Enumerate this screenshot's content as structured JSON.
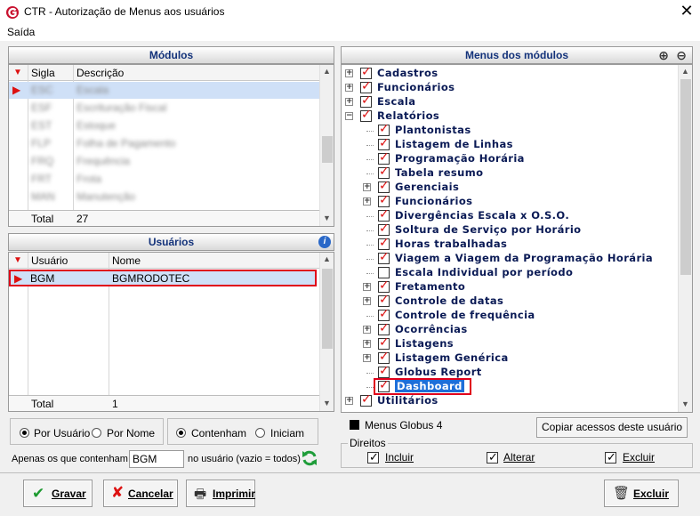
{
  "window": {
    "title": "CTR - Autorização de Menus aos usuários",
    "close": "✕"
  },
  "menu": {
    "saida": "Saída"
  },
  "modulos": {
    "header": "Módulos",
    "columns": [
      "Sigla",
      "Descrição"
    ],
    "rows": [
      {
        "sigla": "ESC",
        "descricao": "Escala"
      },
      {
        "sigla": "ESF",
        "descricao": "Escrituração Fiscal"
      },
      {
        "sigla": "EST",
        "descricao": "Estoque"
      },
      {
        "sigla": "FLP",
        "descricao": "Folha de Pagamento"
      },
      {
        "sigla": "FRQ",
        "descricao": "Frequência"
      },
      {
        "sigla": "FRT",
        "descricao": "Frota"
      },
      {
        "sigla": "MAN",
        "descricao": "Manutenção"
      }
    ],
    "total_label": "Total",
    "total_value": "27"
  },
  "usuarios": {
    "header": "Usuários",
    "columns": [
      "Usuário",
      "Nome"
    ],
    "rows": [
      {
        "usuario": "BGM",
        "nome": "BGMRODOTEC"
      }
    ],
    "total_label": "Total",
    "total_value": "1"
  },
  "menus": {
    "header": "Menus dos módulos",
    "tree": [
      {
        "label": "Cadastros",
        "level": 0,
        "expander": "+",
        "checked": true
      },
      {
        "label": "Funcionários",
        "level": 0,
        "expander": "+",
        "checked": true
      },
      {
        "label": "Escala",
        "level": 0,
        "expander": "+",
        "checked": true
      },
      {
        "label": "Relatórios",
        "level": 0,
        "expander": "-",
        "checked": true
      },
      {
        "label": "Plantonistas",
        "level": 1,
        "expander": "",
        "checked": true
      },
      {
        "label": "Listagem de Linhas",
        "level": 1,
        "expander": "",
        "checked": true
      },
      {
        "label": "Programação Horária",
        "level": 1,
        "expander": "",
        "checked": true
      },
      {
        "label": "Tabela resumo",
        "level": 1,
        "expander": "",
        "checked": true
      },
      {
        "label": "Gerenciais",
        "level": 1,
        "expander": "+",
        "checked": true
      },
      {
        "label": "Funcionários",
        "level": 1,
        "expander": "+",
        "checked": true
      },
      {
        "label": "Divergências Escala x O.S.O.",
        "level": 1,
        "expander": "",
        "checked": true
      },
      {
        "label": "Soltura de Serviço por Horário",
        "level": 1,
        "expander": "",
        "checked": true
      },
      {
        "label": "Horas trabalhadas",
        "level": 1,
        "expander": "",
        "checked": true
      },
      {
        "label": "Viagem a Viagem da Programação Horária",
        "level": 1,
        "expander": "",
        "checked": true
      },
      {
        "label": "Escala Individual por período",
        "level": 1,
        "expander": "",
        "checked": false
      },
      {
        "label": "Fretamento",
        "level": 1,
        "expander": "+",
        "checked": true
      },
      {
        "label": "Controle de datas",
        "level": 1,
        "expander": "+",
        "checked": true
      },
      {
        "label": "Controle de frequência",
        "level": 1,
        "expander": "",
        "checked": true
      },
      {
        "label": "Ocorrências",
        "level": 1,
        "expander": "+",
        "checked": true
      },
      {
        "label": "Listagens",
        "level": 1,
        "expander": "+",
        "checked": true
      },
      {
        "label": "Listagem Genérica",
        "level": 1,
        "expander": "+",
        "checked": true
      },
      {
        "label": "Globus Report",
        "level": 1,
        "expander": "",
        "checked": true
      },
      {
        "label": "Dashboard",
        "level": 1,
        "expander": "",
        "checked": true,
        "selected": true
      },
      {
        "label": "Utilitários",
        "level": 0,
        "expander": "+",
        "checked": true
      }
    ],
    "legend": "Menus Globus 4",
    "copy_button": "Copiar acessos deste usuário"
  },
  "filtros": {
    "por_usuario": "Por Usuário",
    "por_nome": "Por Nome",
    "contenham": "Contenham",
    "iniciam": "Iniciam",
    "apenas_label": "Apenas os que contenham",
    "filter_value": "BGM",
    "no_usuario_label": "no usuário (vazio = todos)"
  },
  "direitos": {
    "title": "Direitos",
    "incluir": "Incluir",
    "alterar": "Alterar",
    "excluir": "Excluir"
  },
  "buttons": {
    "gravar": "Gravar",
    "cancelar": "Cancelar",
    "imprimir": "Imprimir",
    "excluir": "Excluir"
  },
  "colors": {
    "selection": "#cfe0f7",
    "highlight_border": "#e0001b",
    "tree_text": "#0a1a55",
    "header_text": "#13327a"
  }
}
